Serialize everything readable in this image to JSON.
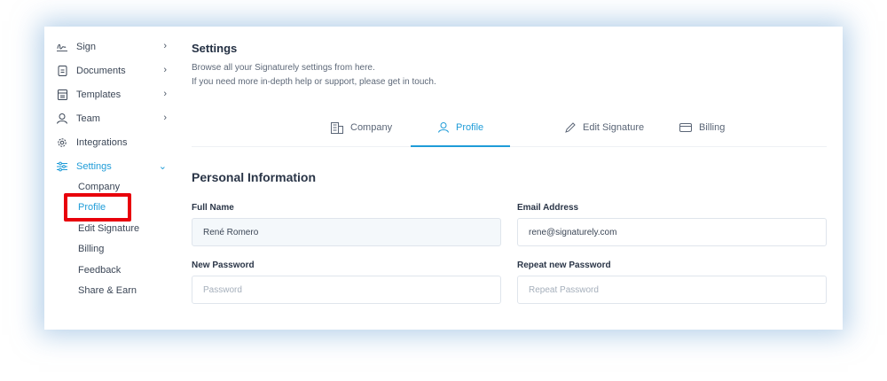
{
  "sidebar": {
    "items": [
      {
        "label": "Sign",
        "chevron": "›",
        "icon": "signature-icon"
      },
      {
        "label": "Documents",
        "chevron": "›",
        "icon": "document-icon"
      },
      {
        "label": "Templates",
        "chevron": "›",
        "icon": "template-icon"
      },
      {
        "label": "Team",
        "chevron": "›",
        "icon": "user-icon"
      },
      {
        "label": "Integrations",
        "icon": "gear-icon"
      },
      {
        "label": "Settings",
        "chevron": "⌄",
        "icon": "sliders-icon"
      }
    ],
    "subitems": [
      {
        "label": "Company"
      },
      {
        "label": "Profile"
      },
      {
        "label": "Edit Signature"
      },
      {
        "label": "Billing"
      },
      {
        "label": "Feedback"
      },
      {
        "label": "Share & Earn"
      }
    ]
  },
  "main": {
    "title": "Settings",
    "desc_line1": "Browse all your Signaturely settings from here.",
    "desc_line2": "If you need more in-depth help or support, please get in touch.",
    "tabs": [
      {
        "label": "Company",
        "icon": "building-icon"
      },
      {
        "label": "Profile",
        "icon": "user-icon"
      },
      {
        "label": "Edit Signature",
        "icon": "pencil-icon"
      },
      {
        "label": "Billing",
        "icon": "card-icon"
      }
    ],
    "section_title": "Personal Information",
    "form": {
      "full_name_label": "Full Name",
      "full_name_value": "René Romero",
      "email_label": "Email Address",
      "email_value": "rene@signaturely.com",
      "new_password_label": "New Password",
      "new_password_placeholder": "Password",
      "repeat_password_label": "Repeat new Password",
      "repeat_password_placeholder": "Repeat Password"
    }
  },
  "colors": {
    "accent": "#1f9cd8",
    "highlight": "#e8000b",
    "text": "#2f3a4a"
  }
}
